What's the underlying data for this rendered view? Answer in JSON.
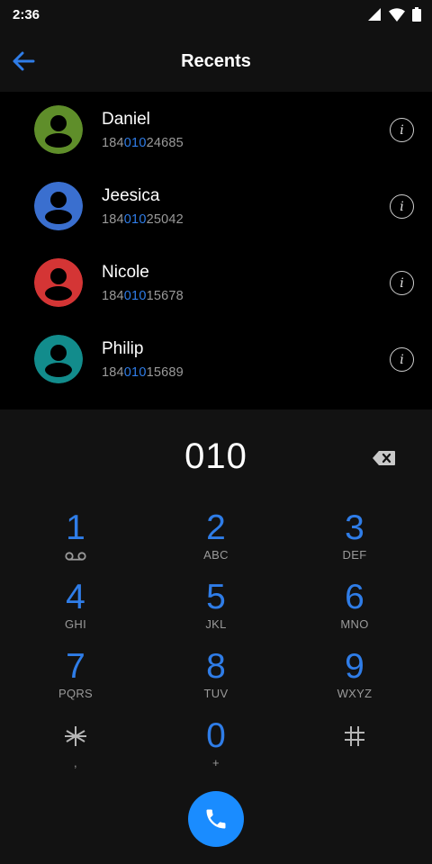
{
  "status_bar": {
    "time": "2:36"
  },
  "app_bar": {
    "title": "Recents"
  },
  "contacts": [
    {
      "name": "Daniel",
      "number_prefix": "184",
      "number_match": "010",
      "number_suffix": "24685",
      "avatar_color": "#5f8e2a"
    },
    {
      "name": "Jeesica",
      "number_prefix": "184",
      "number_match": "010",
      "number_suffix": "25042",
      "avatar_color": "#3a6fcf"
    },
    {
      "name": "Nicole",
      "number_prefix": "184",
      "number_match": "010",
      "number_suffix": "15678",
      "avatar_color": "#d43535"
    },
    {
      "name": "Philip",
      "number_prefix": "184",
      "number_match": "010",
      "number_suffix": "15689",
      "avatar_color": "#128c8c"
    }
  ],
  "info_glyph": "i",
  "dialpad": {
    "entered_digits": "010",
    "keys": [
      {
        "digit": "1",
        "letters": ""
      },
      {
        "digit": "2",
        "letters": "ABC"
      },
      {
        "digit": "3",
        "letters": "DEF"
      },
      {
        "digit": "4",
        "letters": "GHI"
      },
      {
        "digit": "5",
        "letters": "JKL"
      },
      {
        "digit": "6",
        "letters": "MNO"
      },
      {
        "digit": "7",
        "letters": "PQRS"
      },
      {
        "digit": "8",
        "letters": "TUV"
      },
      {
        "digit": "9",
        "letters": "WXYZ"
      },
      {
        "digit": "*",
        "letters": ","
      },
      {
        "digit": "0",
        "letters": "+"
      },
      {
        "digit": "#",
        "letters": ""
      }
    ]
  },
  "icons": {
    "back": "arrow-left-icon",
    "voicemail": "voicemail-icon",
    "backspace": "backspace-icon",
    "call": "phone-icon"
  },
  "colors": {
    "accent": "#2f7de8",
    "call_button": "#1a8cff",
    "dialpad_bg": "#121212",
    "list_bg": "#000000"
  }
}
